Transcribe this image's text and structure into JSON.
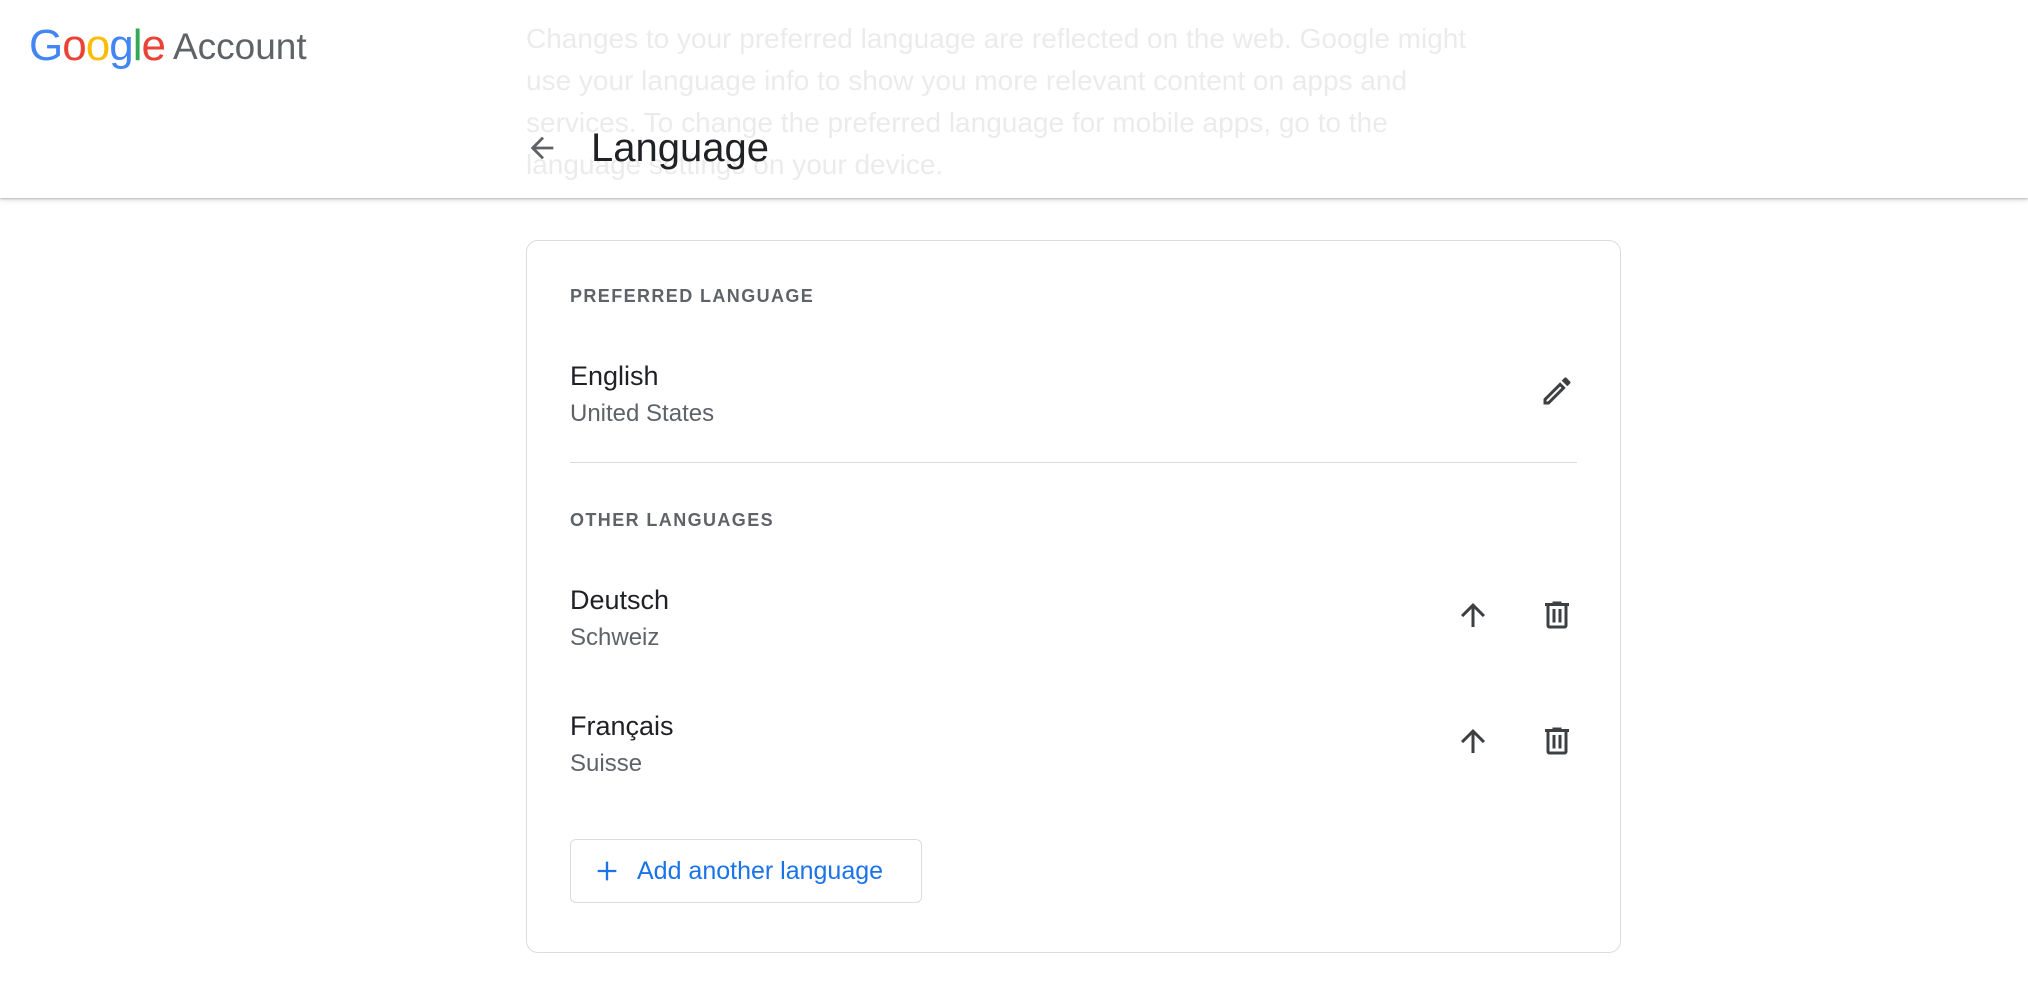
{
  "header": {
    "logo": {
      "letters": [
        "G",
        "o",
        "o",
        "g",
        "l",
        "e"
      ],
      "letter_colors": [
        "#4285F4",
        "#EA4335",
        "#FBBC05",
        "#4285F4",
        "#34A853",
        "#EA4335"
      ],
      "suffix": "Account"
    },
    "background_text": "Changes to your preferred language are reflected on the web. Google might use your language info to show you more relevant content on apps and services. To change the preferred language for mobile apps, go to the language settings on your device.",
    "back_icon": "arrow-back-icon",
    "title": "Language"
  },
  "preferred": {
    "label": "PREFERRED LANGUAGE",
    "language": {
      "name": "English",
      "region": "United States",
      "edit_icon": "pencil-icon"
    }
  },
  "other": {
    "label": "OTHER LANGUAGES",
    "languages": [
      {
        "name": "Deutsch",
        "region": "Schweiz",
        "move_icon": "arrow-up-icon",
        "delete_icon": "trash-icon"
      },
      {
        "name": "Français",
        "region": "Suisse",
        "move_icon": "arrow-up-icon",
        "delete_icon": "trash-icon"
      }
    ]
  },
  "add_button": {
    "icon": "plus-icon",
    "label": "Add another language"
  },
  "colors": {
    "accent": "#1a73e8",
    "icon": "#3c4043",
    "text_primary": "#202124",
    "text_secondary": "#5f6368",
    "divider": "#dadce0"
  }
}
